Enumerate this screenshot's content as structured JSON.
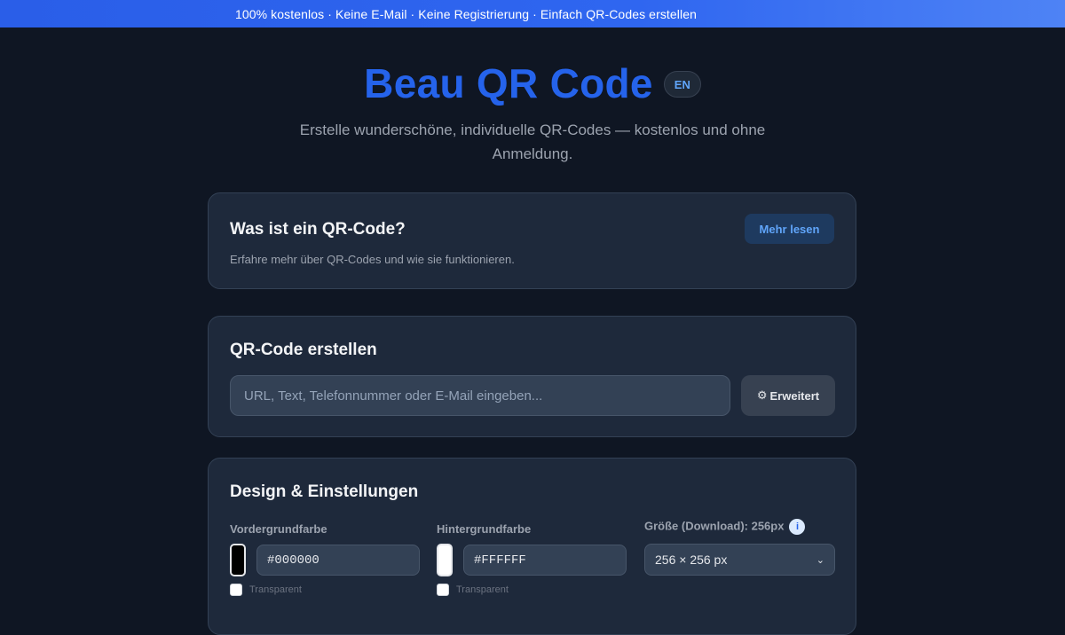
{
  "banner": {
    "text": "100% kostenlos · Keine E-Mail · Keine Registrierung · Einfach QR-Codes erstellen"
  },
  "header": {
    "title": "Beau QR Code",
    "lang_button": "EN",
    "subtitle": "Erstelle wunderschöne, individuelle QR-Codes — kostenlos und ohne Anmeldung."
  },
  "info_card": {
    "title": "Was ist ein QR-Code?",
    "description": "Erfahre mehr über QR-Codes und wie sie funktionieren.",
    "more_button": "Mehr lesen"
  },
  "create_card": {
    "title": "QR-Code erstellen",
    "input_placeholder": "URL, Text, Telefonnummer oder E-Mail eingeben...",
    "input_value": "",
    "advanced_button": "Erweitert",
    "advanced_icon": "gear-icon"
  },
  "design_card": {
    "title": "Design & Einstellungen",
    "foreground": {
      "label": "Vordergrundfarbe",
      "value": "#000000",
      "color": "#000000",
      "transparent_label": "Transparent",
      "transparent_checked": false
    },
    "background": {
      "label": "Hintergrundfarbe",
      "value": "#FFFFFF",
      "color": "#FFFFFF",
      "transparent_label": "Transparent",
      "transparent_checked": false
    },
    "size": {
      "label": "Größe (Download): 256px",
      "info_icon": "i",
      "selected": "256 × 256 px"
    }
  },
  "colors": {
    "accent": "#2563eb",
    "banner": "#2f66f0",
    "background": "#0f1623",
    "card": "#1e293b"
  }
}
